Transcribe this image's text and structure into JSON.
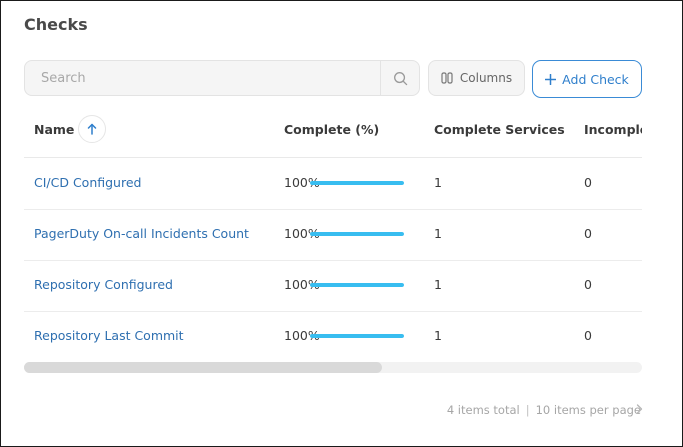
{
  "page": {
    "title": "Checks"
  },
  "toolbar": {
    "search_placeholder": "Search",
    "columns_label": "Columns",
    "add_label": "Add Check"
  },
  "table": {
    "headers": [
      "Name",
      "Complete (%)",
      "Complete Services",
      "Incomplete"
    ],
    "rows": [
      {
        "name": "CI/CD Configured",
        "complete_pct_label": "100%",
        "complete_fraction": 1.0,
        "complete_services": "1",
        "incomplete": "0"
      },
      {
        "name": "PagerDuty On-call Incidents Count",
        "complete_pct_label": "100%",
        "complete_fraction": 1.0,
        "complete_services": "1",
        "incomplete": "0"
      },
      {
        "name": "Repository Configured",
        "complete_pct_label": "100%",
        "complete_fraction": 1.0,
        "complete_services": "1",
        "incomplete": "0"
      },
      {
        "name": "Repository Last Commit",
        "complete_pct_label": "100%",
        "complete_fraction": 1.0,
        "complete_services": "1",
        "incomplete": "0"
      }
    ]
  },
  "pagination": {
    "total_label": "4 items total",
    "per_page_label": "10 items per page",
    "separator": "|"
  },
  "colors": {
    "accent": "#2f7fcc",
    "progress": "#38bdf0",
    "link": "#2e6fb0"
  },
  "icons": {
    "search": "search-icon",
    "columns": "columns-icon",
    "add": "plus-icon",
    "sort": "arrow-up-icon",
    "next": "chevron-right-icon"
  }
}
